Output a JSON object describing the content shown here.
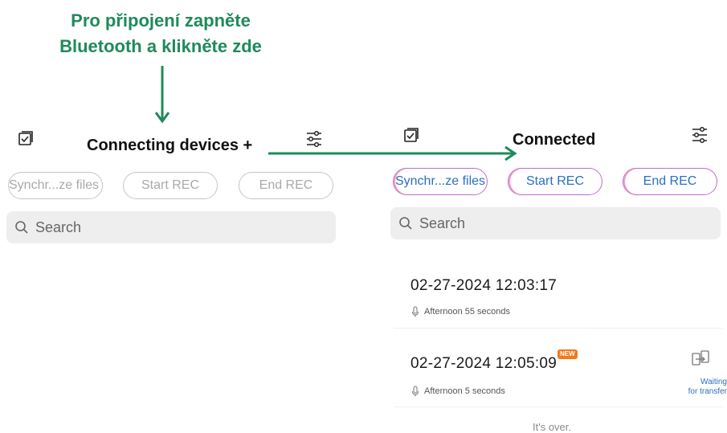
{
  "instruction": {
    "line1": "Pro připojení zapněte",
    "line2": "Bluetooth a klikněte zde"
  },
  "colors": {
    "accent_green": "#1f8a5b",
    "button_text_blue": "#2a6fc5",
    "new_badge": "#f07a1e"
  },
  "left_panel": {
    "title": "Connecting devices +",
    "icons": {
      "left": "checklist-icon",
      "right": "sliders-icon"
    },
    "buttons": {
      "sync": "Synchr...ze files",
      "start": "Start REC",
      "end": "End REC"
    },
    "search_placeholder": "Search"
  },
  "right_panel": {
    "title": "Connected",
    "icons": {
      "left": "checklist-icon",
      "right": "sliders-icon"
    },
    "buttons": {
      "sync": "Synchr...ze files",
      "start": "Start REC",
      "end": "End REC"
    },
    "search_placeholder": "Search",
    "recordings": [
      {
        "datetime": "02-27-2024 12:03:17",
        "period": "Afternoon",
        "duration": "55 seconds"
      },
      {
        "datetime": "02-27-2024 12:05:09",
        "period": "Afternoon",
        "duration": "5 seconds",
        "badge": "NEW",
        "status_line1": "Waiting",
        "status_line2": "for transfer"
      }
    ],
    "end_text": "It's over."
  }
}
